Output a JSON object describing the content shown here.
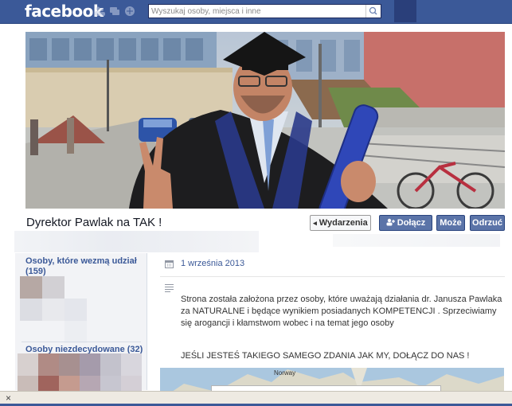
{
  "header": {
    "logo": "facebook",
    "search_placeholder": "Wyszukaj osoby, miejsca i inne",
    "icons": [
      "friend-requests-icon",
      "messages-icon",
      "notifications-icon",
      "search-icon"
    ]
  },
  "event": {
    "title": "Dyrektor Pawlak na TAK !",
    "buttons": {
      "events": "Wydarzenia",
      "join": "Dołącz",
      "maybe": "Może",
      "decline": "Odrzuć"
    },
    "date": "1 września 2013",
    "description": "Strona została założona przez osoby, które uważają działania dr. Janusza Pawlaka za NATURALNE i będące wynikiem posiadanych KOMPETENCJI . Sprzeciwiamy się arogancji i kłamstwom wobec i na temat jego osoby",
    "call_to_action": "JEŚLI JESTEŚ TAKIEGO SAMEGO ZDANIA JAK MY, DOŁĄCZ DO NAS !"
  },
  "sidebar": {
    "going_label": "Osoby, które wezmą udział",
    "going_count": "(159)",
    "maybe_label": "Osoby niezdecydowane (32)"
  },
  "map": {
    "label": "Norway"
  },
  "colors": {
    "brand": "#3b5998",
    "button_blue": "#5b74a8",
    "link": "#3b5998"
  }
}
